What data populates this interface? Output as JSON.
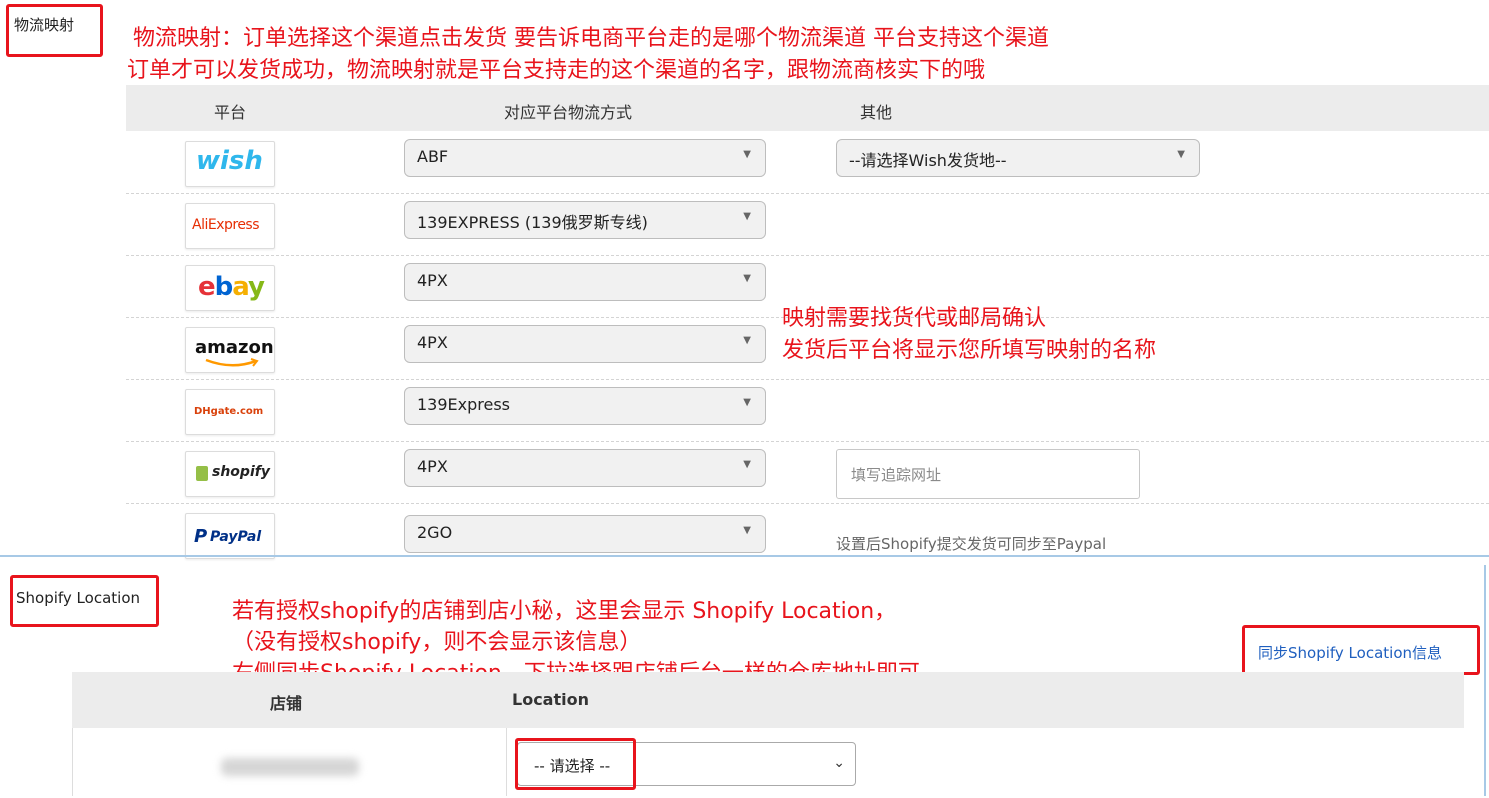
{
  "logistics_mapping": {
    "section_label": "物流映射",
    "annotation_line1": "物流映射：订单选择这个渠道点击发货  要告诉电商平台走的是哪个物流渠道    平台支持这个渠道",
    "annotation_line2": "订单才可以发货成功，物流映射就是平台支持走的这个渠道的名字，跟物流商核实下的哦",
    "columns": [
      "平台",
      "对应平台物流方式",
      "其他"
    ],
    "rows": [
      {
        "platform": "wish",
        "logo_text": "wish",
        "shipping": "ABF",
        "other_select": "--请选择Wish发货地--"
      },
      {
        "platform": "aliexpress",
        "logo_text": "AliExpress",
        "shipping": "139EXPRESS (139俄罗斯专线)"
      },
      {
        "platform": "ebay",
        "logo_text": "ebay",
        "shipping": "4PX"
      },
      {
        "platform": "amazon",
        "logo_text": "amazon",
        "shipping": "4PX"
      },
      {
        "platform": "dhgate",
        "logo_text": "DHgate.com",
        "shipping": "139Express"
      },
      {
        "platform": "shopify",
        "logo_text": "shopify",
        "shipping": "4PX",
        "tracking_placeholder": "填写追踪网址"
      },
      {
        "platform": "paypal",
        "logo_text": "PayPal",
        "shipping": "2GO",
        "note": "设置后Shopify提交发货可同步至Paypal"
      }
    ],
    "middle_annotation_line1": "映射需要找货代或邮局确认",
    "middle_annotation_line2": "发货后平台将显示您所填写映射的名称"
  },
  "shopify_location": {
    "section_label": "Shopify Location",
    "annotation_line1": "若有授权shopify的店铺到店小秘，这里会显示 Shopify Location，",
    "annotation_line2": "（没有授权shopify，则不会显示该信息）",
    "annotation_line3": "右侧同步Shopify Location，下拉选择跟店铺后台一样的仓库地址即可",
    "sync_link": "同步Shopify Location信息",
    "columns": [
      "店铺",
      "Location"
    ],
    "row_select": "-- 请选择 --"
  },
  "colors": {
    "annotation_red": "#e8141c",
    "header_gray": "#ececec",
    "link_blue": "#1f5fbf"
  }
}
